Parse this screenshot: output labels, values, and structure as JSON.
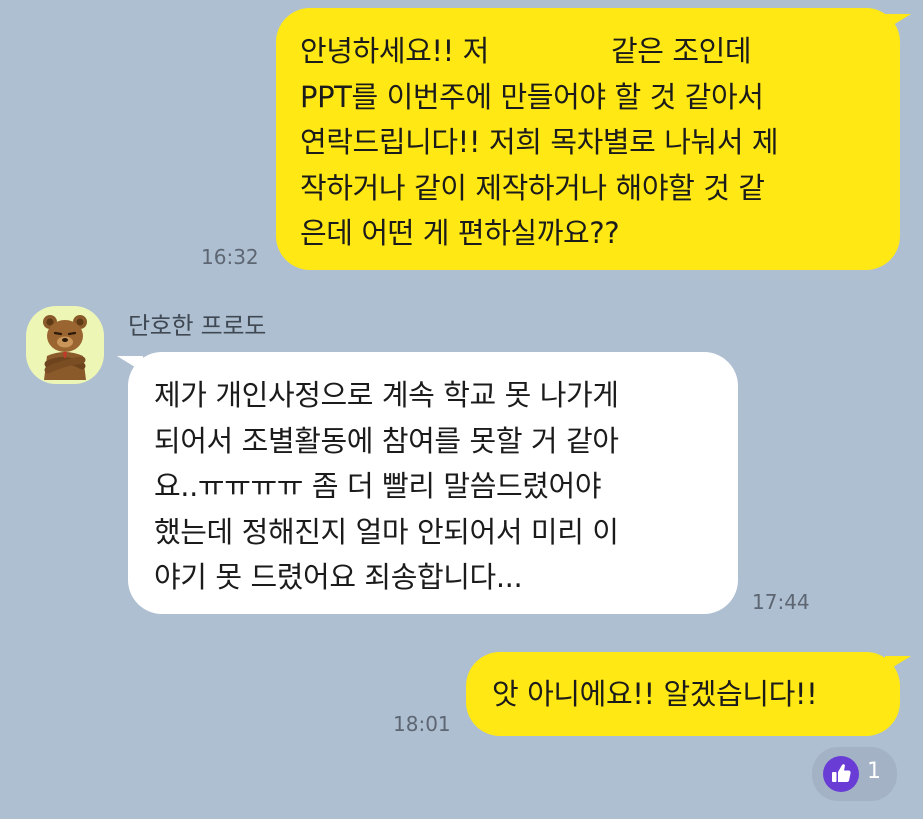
{
  "messages": [
    {
      "side": "outgoing",
      "lines": [
        "안녕하세요!! 저",
        "같은 조인데",
        "PPT를 이번주에 만들어야 할 것 같아서",
        "연락드립니다!! 저희 목차별로 나눠서 제",
        "작하거나 같이 제작하거나 해야할 것 같",
        "은데 어떤 게 편하실까요??"
      ],
      "time": "16:32"
    },
    {
      "side": "incoming",
      "sender": "단호한 프로도",
      "lines": [
        "제가 개인사정으로 계속 학교 못 나가게",
        "되어서 조별활동에 참여를 못할 거 같아",
        "요..ㅠㅠㅠㅠ 좀 더 빨리 말씀드렸어야",
        "했는데 정해진지 얼마 안되어서 미리 이",
        "야기 못 드렸어요 죄송합니다..."
      ],
      "time": "17:44"
    },
    {
      "side": "outgoing",
      "lines": [
        "앗 아니에요!! 알겠습니다!!"
      ],
      "time": "18:01"
    }
  ],
  "reaction": {
    "icon": "thumbs-up-icon",
    "count": "1"
  },
  "colors": {
    "background": "#aebfd1",
    "outgoing_bubble": "#ffe813",
    "incoming_bubble": "#ffffff",
    "reaction_icon": "#6a3cd6"
  }
}
